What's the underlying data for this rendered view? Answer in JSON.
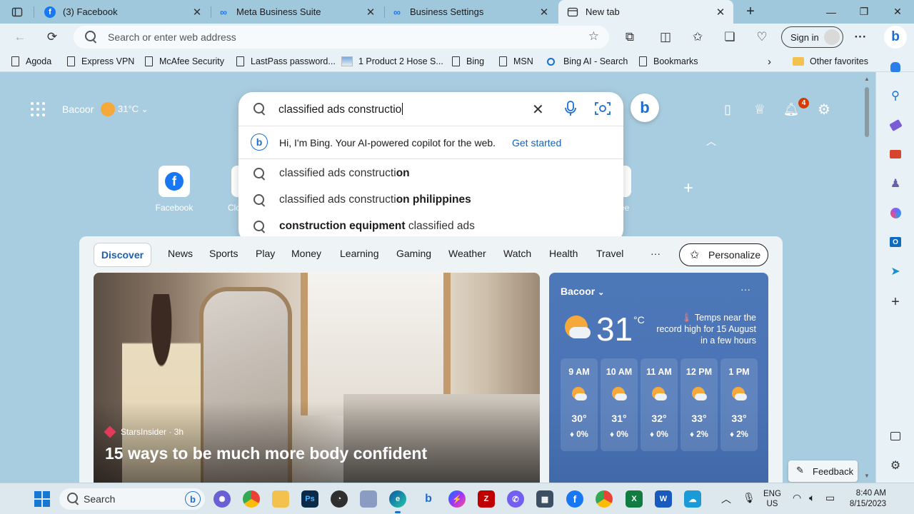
{
  "tabs": [
    {
      "title": "(3) Facebook",
      "icon": "facebook-icon",
      "active": false
    },
    {
      "title": "Meta Business Suite",
      "icon": "meta-icon",
      "active": false
    },
    {
      "title": "Business Settings",
      "icon": "meta-icon",
      "active": false
    },
    {
      "title": "New tab",
      "icon": "new-tab-page-icon",
      "active": true
    }
  ],
  "toolbar": {
    "address_placeholder": "Search or enter web address",
    "signin_label": "Sign in"
  },
  "favorites": [
    {
      "label": "Agoda"
    },
    {
      "label": "Express VPN"
    },
    {
      "label": "McAfee Security"
    },
    {
      "label": "LastPass password..."
    },
    {
      "label": "1 Product 2 Hose S..."
    },
    {
      "label": "Bing"
    },
    {
      "label": "MSN"
    },
    {
      "label": "Bing AI - Search"
    },
    {
      "label": "Bookmarks"
    }
  ],
  "other_favorites": "Other favorites",
  "ntp": {
    "location": "Bacoor",
    "temp": "31°C",
    "notification_count": "4",
    "quick_links": [
      {
        "label": "Facebook"
      },
      {
        "label": "Clo"
      },
      {
        "label": "ee"
      }
    ]
  },
  "search": {
    "value": "classified ads constructio",
    "bing_prompt": "Hi, I'm Bing. Your AI-powered copilot for the web.",
    "bing_cta": "Get started",
    "suggestions": [
      {
        "plain_before": "classified ads constructi",
        "bold": "on",
        "plain_after": ""
      },
      {
        "plain_before": "classified ads constructi",
        "bold": "on philippines",
        "plain_after": ""
      },
      {
        "plain_before": "",
        "bold": "construction equipment",
        "plain_after": " classified ads"
      }
    ]
  },
  "feed": {
    "nav": [
      "Discover",
      "News",
      "Sports",
      "Play",
      "Money",
      "Learning",
      "Gaming",
      "Weather",
      "Watch",
      "Health",
      "Travel",
      "···"
    ],
    "personalize_label": "Personalize",
    "hero": {
      "source": "StarsInsider · 3h",
      "title": "15 ways to be much more body confident"
    },
    "weather": {
      "location": "Bacoor",
      "more": "···",
      "temp": "31",
      "unit": "°C",
      "alert": "Temps near the record high for 15 August in a few hours",
      "hours": [
        {
          "time": "9 AM",
          "temp": "30°",
          "precip": "0%"
        },
        {
          "time": "10 AM",
          "temp": "31°",
          "precip": "0%"
        },
        {
          "time": "11 AM",
          "temp": "32°",
          "precip": "0%"
        },
        {
          "time": "12 PM",
          "temp": "33°",
          "precip": "2%"
        },
        {
          "time": "1 PM",
          "temp": "33°",
          "precip": "2%"
        }
      ]
    }
  },
  "feedback_label": "Feedback",
  "taskbar": {
    "search_label": "Search",
    "lang": "ENG",
    "region": "US",
    "time": "8:40 AM",
    "date": "8/15/2023"
  }
}
